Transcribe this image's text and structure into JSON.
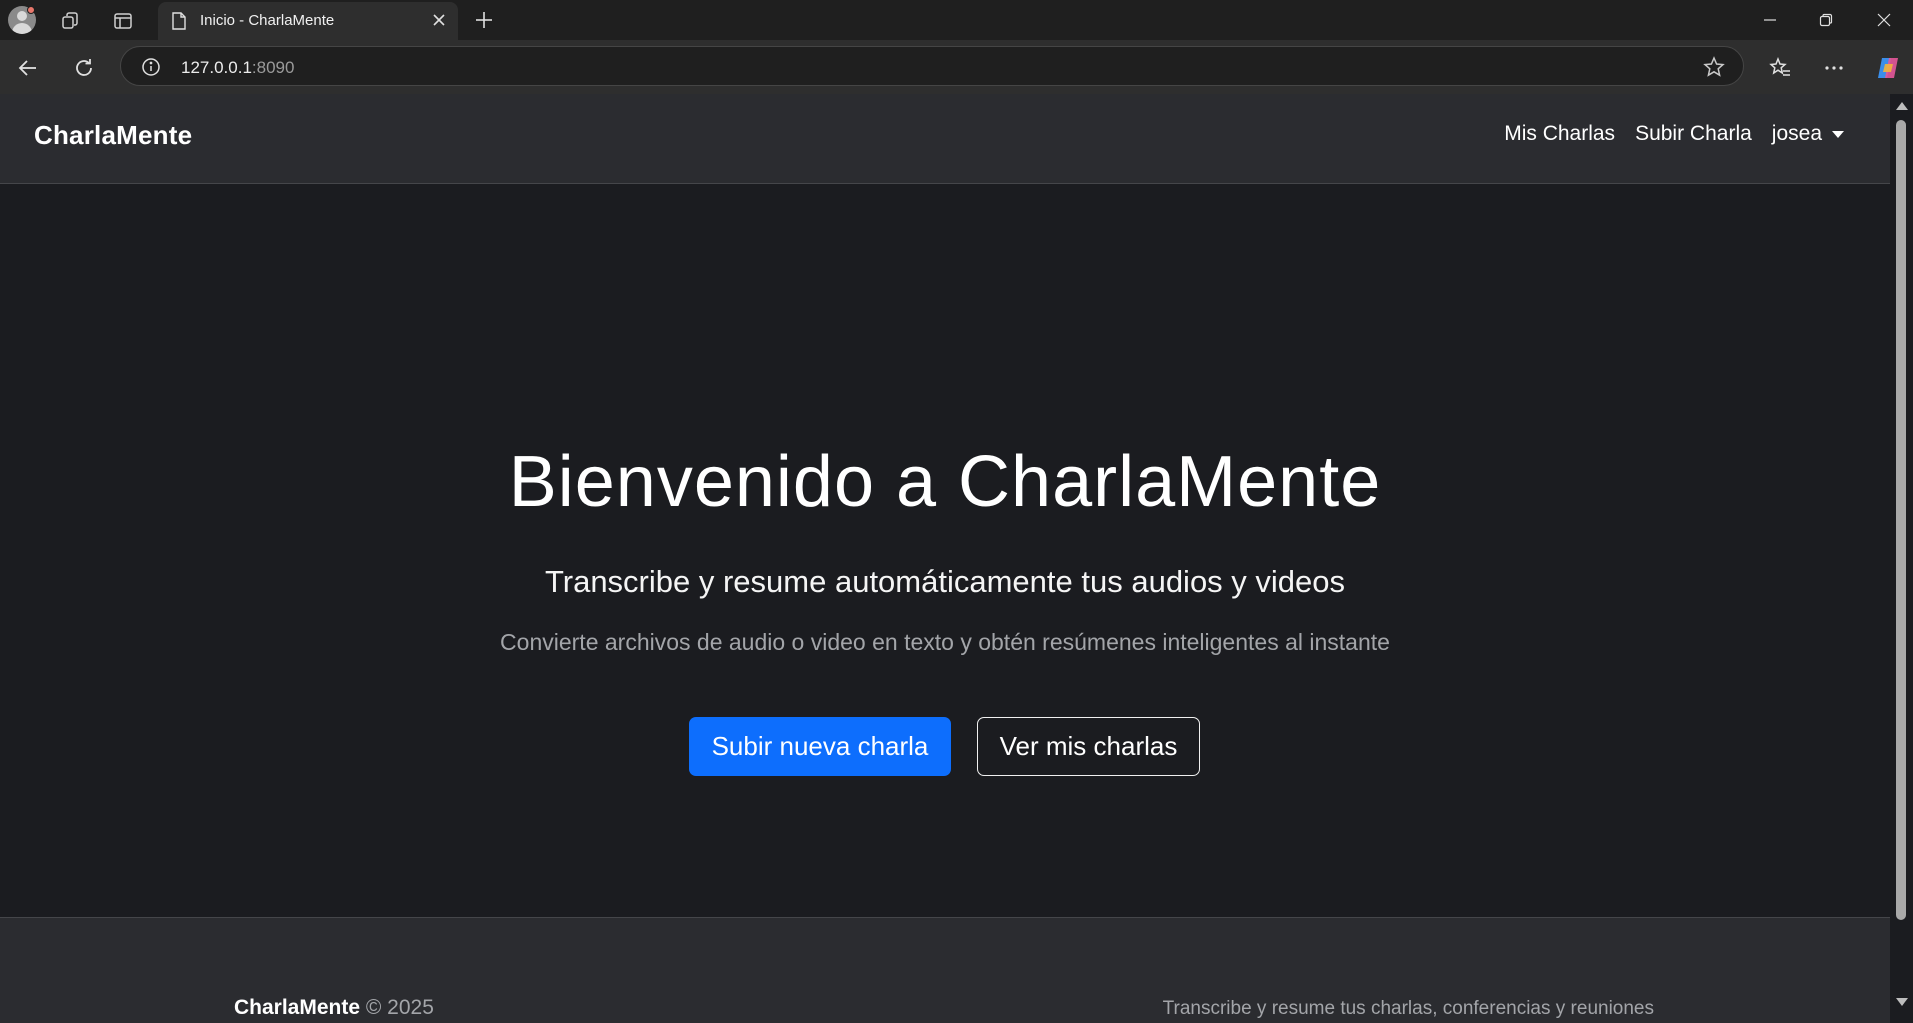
{
  "browser": {
    "tab_title": "Inicio - CharlaMente",
    "url_host": "127.0.0.1",
    "url_port": ":8090"
  },
  "navbar": {
    "brand": "CharlaMente",
    "links": [
      "Mis Charlas",
      "Subir Charla"
    ],
    "user": "josea"
  },
  "hero": {
    "title": "Bienvenido a CharlaMente",
    "subtitle": "Transcribe y resume automáticamente tus audios y videos",
    "lead": "Convierte archivos de audio o video en texto y obtén resúmenes inteligentes al instante",
    "primary_button": "Subir nueva charla",
    "secondary_button": "Ver mis charlas"
  },
  "footer": {
    "brand": "CharlaMente",
    "copyright": " © 2025",
    "tagline": "Transcribe y resume tus charlas, conferencias y reuniones"
  },
  "colors": {
    "page_bg": "#1b1c20",
    "navbar_bg": "#2b2c30",
    "primary": "#0d6efd",
    "muted_text": "#a3a5a9"
  }
}
